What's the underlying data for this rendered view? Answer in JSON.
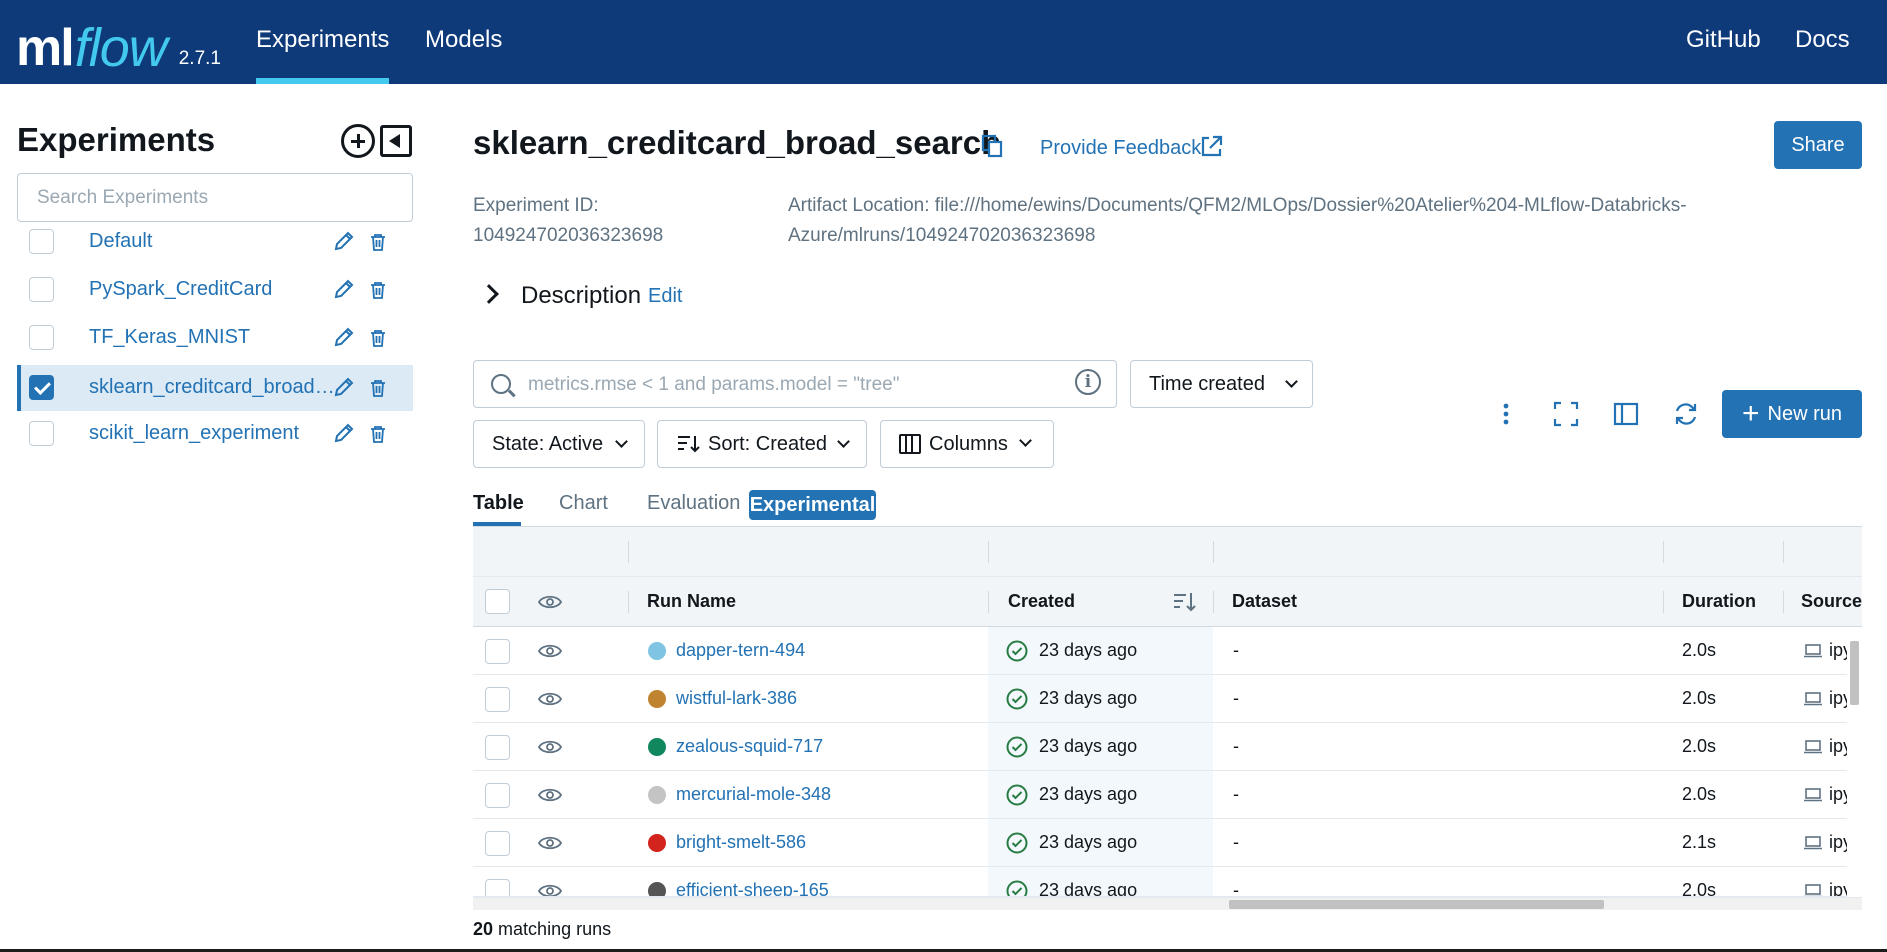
{
  "header": {
    "logo_ml": "ml",
    "logo_flow": "flow",
    "version": "2.7.1",
    "nav": [
      "Experiments",
      "Models"
    ],
    "right_links": [
      "GitHub",
      "Docs"
    ]
  },
  "sidebar": {
    "title": "Experiments",
    "search_placeholder": "Search Experiments",
    "items": [
      {
        "label": "Default",
        "checked": false
      },
      {
        "label": "PySpark_CreditCard",
        "checked": false
      },
      {
        "label": "TF_Keras_MNIST",
        "checked": false
      },
      {
        "label": "sklearn_creditcard_broad_search",
        "checked": true
      },
      {
        "label": "scikit_learn_experiment",
        "checked": false
      }
    ]
  },
  "experiment": {
    "title": "sklearn_creditcard_broad_search",
    "feedback": "Provide Feedback",
    "share": "Share",
    "id_label": "Experiment ID:",
    "id_value": "104924702036323698",
    "artifact_line1": "Artifact Location: file:///home/ewins/Documents/QFM2/MLOps/Dossier%20Atelier%204-MLflow-Databricks-",
    "artifact_line2": "Azure/mlruns/104924702036323698",
    "description_label": "Description",
    "description_edit": "Edit"
  },
  "filters": {
    "search_placeholder": "metrics.rmse < 1 and params.model = \"tree\"",
    "time_created": "Time created",
    "state": "State: Active",
    "sort": "Sort: Created",
    "columns": "Columns",
    "new_run": "New run"
  },
  "tabs": [
    "Table",
    "Chart",
    "Evaluation",
    "Experimental"
  ],
  "table": {
    "headers": {
      "run_name": "Run Name",
      "created": "Created",
      "dataset": "Dataset",
      "duration": "Duration",
      "source": "Source"
    },
    "rows": [
      {
        "name": "dapper-tern-494",
        "color": "#7fc5e3",
        "created": "23 days ago",
        "dataset": "-",
        "duration": "2.0s",
        "source": "ipykernel_launcher.py"
      },
      {
        "name": "wistful-lark-386",
        "color": "#c08330",
        "created": "23 days ago",
        "dataset": "-",
        "duration": "2.0s",
        "source": "ipykernel_launcher.py"
      },
      {
        "name": "zealous-squid-717",
        "color": "#11875e",
        "created": "23 days ago",
        "dataset": "-",
        "duration": "2.0s",
        "source": "ipykernel_launcher.py"
      },
      {
        "name": "mercurial-mole-348",
        "color": "#c4c4c4",
        "created": "23 days ago",
        "dataset": "-",
        "duration": "2.0s",
        "source": "ipykernel_launcher.py"
      },
      {
        "name": "bright-smelt-586",
        "color": "#d3231d",
        "created": "23 days ago",
        "dataset": "-",
        "duration": "2.1s",
        "source": "ipykernel_launcher.py"
      },
      {
        "name": "efficient-sheep-165",
        "color": "#555555",
        "created": "23 days ago",
        "dataset": "-",
        "duration": "2.0s",
        "source": "ipykernel_launcher.py"
      }
    ]
  },
  "footer": {
    "count": "20",
    "label": "matching runs"
  },
  "colors": {
    "header_bg": "#0e3a7a",
    "accent": "#2272b4",
    "logo_flow": "#43c9ed",
    "success": "#277c43"
  }
}
